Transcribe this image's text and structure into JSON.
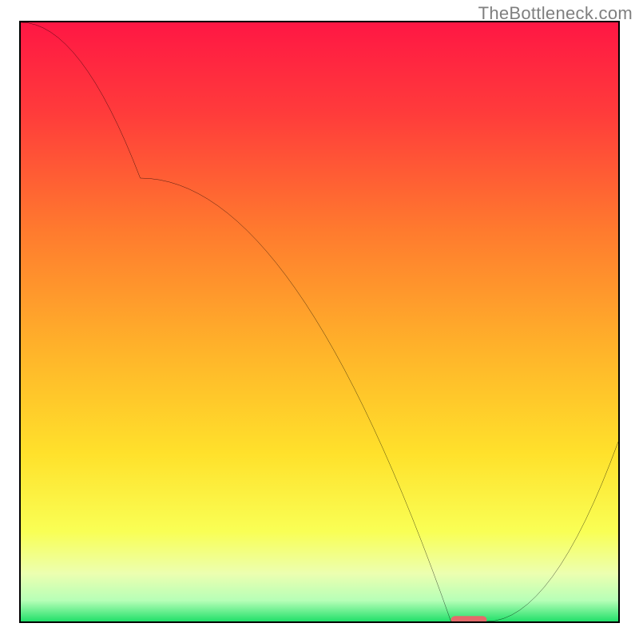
{
  "meta": {
    "source_label": "TheBottleneck.com"
  },
  "chart_data": {
    "type": "line",
    "title": "",
    "xlabel": "",
    "ylabel": "",
    "xlim": [
      0,
      100
    ],
    "ylim": [
      0,
      100
    ],
    "grid": false,
    "legend": false,
    "x": [
      0,
      20,
      72,
      78,
      100
    ],
    "values": [
      100,
      74,
      0,
      0,
      30
    ],
    "minimum_marker": {
      "x_start": 72,
      "x_end": 78,
      "y": 0,
      "color": "#e46a6a"
    },
    "gradient_stops": [
      {
        "offset": 0.0,
        "color": "#ff1744"
      },
      {
        "offset": 0.15,
        "color": "#ff3b3b"
      },
      {
        "offset": 0.35,
        "color": "#ff7b2e"
      },
      {
        "offset": 0.55,
        "color": "#ffb42a"
      },
      {
        "offset": 0.72,
        "color": "#ffe12b"
      },
      {
        "offset": 0.85,
        "color": "#f9ff55"
      },
      {
        "offset": 0.92,
        "color": "#ecffb0"
      },
      {
        "offset": 0.965,
        "color": "#b7ffb7"
      },
      {
        "offset": 1.0,
        "color": "#22e06a"
      }
    ]
  }
}
